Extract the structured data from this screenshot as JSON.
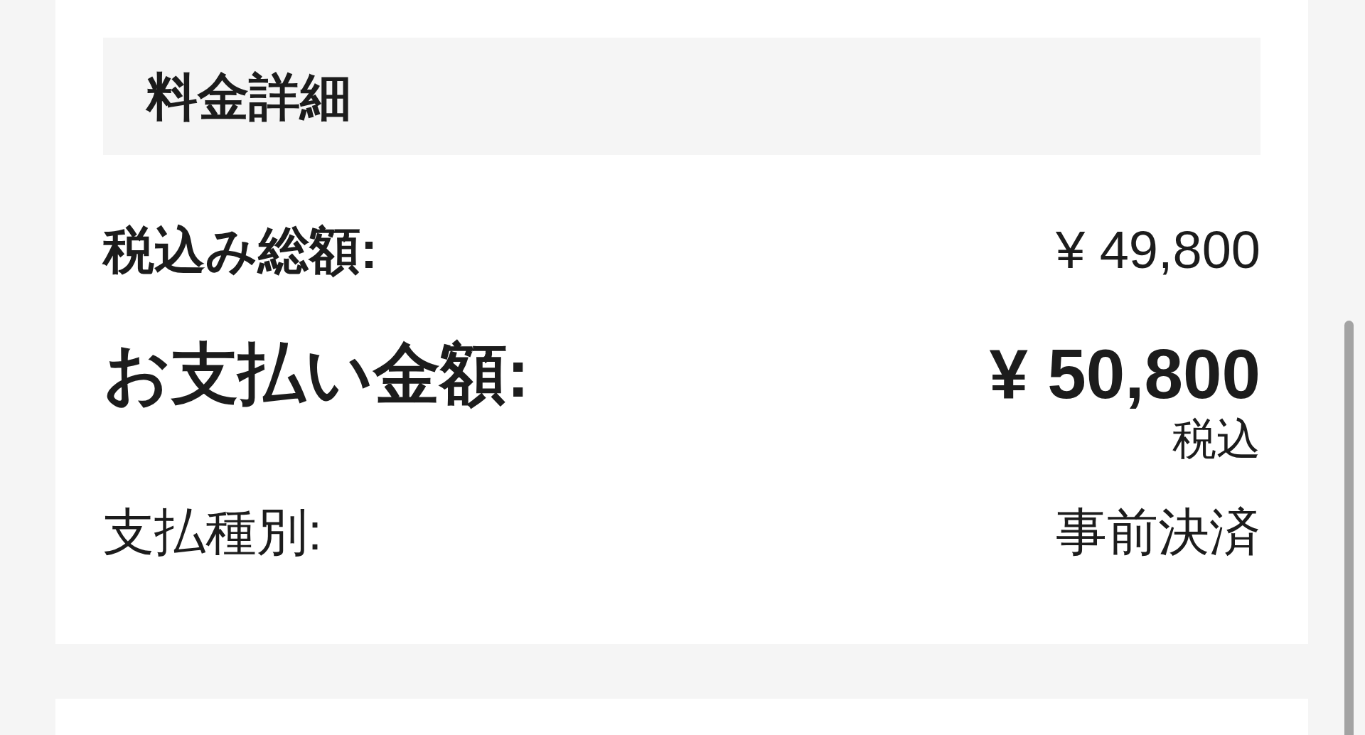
{
  "section": {
    "title": "料金詳細"
  },
  "rows": [
    {
      "kind": "subtotal",
      "label": "税込み総額:",
      "value": "¥ 49,800"
    },
    {
      "kind": "payment",
      "label": "お支払い金額:",
      "value": "¥ 50,800",
      "note": "税込"
    },
    {
      "kind": "plain",
      "label": "支払種別:",
      "value": "事前決済"
    }
  ]
}
